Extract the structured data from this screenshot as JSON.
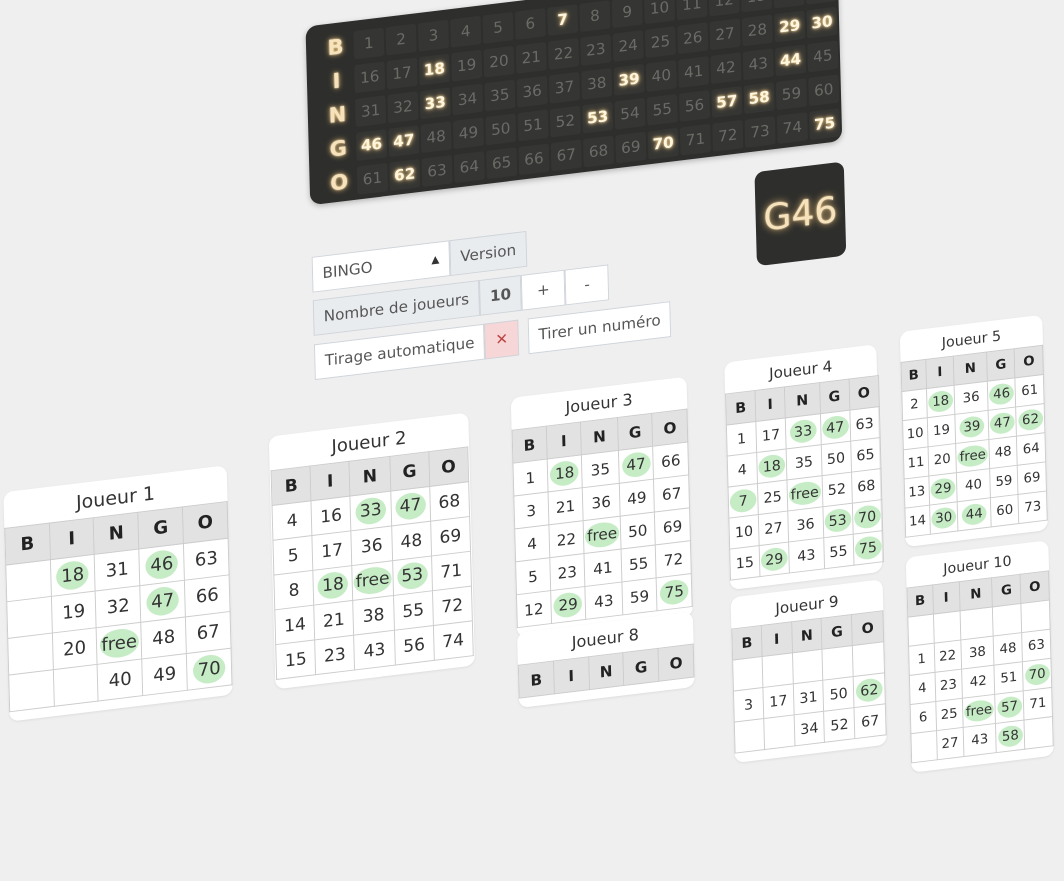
{
  "board": {
    "letters": [
      "B",
      "I",
      "N",
      "G",
      "O"
    ],
    "drawn": [
      7,
      18,
      29,
      30,
      33,
      39,
      44,
      46,
      47,
      53,
      57,
      58,
      62,
      70,
      75
    ]
  },
  "last_drawn": "G46",
  "controls": {
    "mode_value": "BINGO",
    "version_label": "Version",
    "players_label": "Nombre de joueurs",
    "players_count": "10",
    "plus_label": "+",
    "minus_label": "-",
    "auto_label": "Tirage automatique",
    "auto_toggle": "✕",
    "draw_button": "Tirer un numéro"
  },
  "cards": [
    {
      "title": "Joueur 1",
      "rows": [
        [
          "",
          "18",
          "31",
          "46",
          "63"
        ],
        [
          "",
          "19",
          "32",
          "47",
          "66"
        ],
        [
          "",
          "20",
          "free",
          "48",
          "67"
        ],
        [
          "",
          "",
          "40",
          "49",
          "70"
        ]
      ]
    },
    {
      "title": "Joueur 2",
      "rows": [
        [
          "4",
          "16",
          "33",
          "47",
          "68"
        ],
        [
          "5",
          "17",
          "36",
          "48",
          "69"
        ],
        [
          "8",
          "18",
          "free",
          "53",
          "71"
        ],
        [
          "14",
          "21",
          "38",
          "55",
          "72"
        ],
        [
          "15",
          "23",
          "43",
          "56",
          "74"
        ]
      ]
    },
    {
      "title": "Joueur 3",
      "rows": [
        [
          "1",
          "18",
          "35",
          "47",
          "66"
        ],
        [
          "3",
          "21",
          "36",
          "49",
          "67"
        ],
        [
          "4",
          "22",
          "free",
          "50",
          "69"
        ],
        [
          "5",
          "23",
          "41",
          "55",
          "72"
        ],
        [
          "12",
          "29",
          "43",
          "59",
          "75"
        ]
      ]
    },
    {
      "title": "Joueur 4",
      "rows": [
        [
          "1",
          "17",
          "33",
          "47",
          "63"
        ],
        [
          "4",
          "18",
          "35",
          "50",
          "65"
        ],
        [
          "7",
          "25",
          "free",
          "52",
          "68"
        ],
        [
          "10",
          "27",
          "36",
          "53",
          "70"
        ],
        [
          "15",
          "29",
          "43",
          "55",
          "75"
        ]
      ]
    },
    {
      "title": "Joueur 5",
      "rows": [
        [
          "2",
          "18",
          "36",
          "46",
          "61"
        ],
        [
          "10",
          "19",
          "39",
          "47",
          "62"
        ],
        [
          "11",
          "20",
          "free",
          "48",
          "64"
        ],
        [
          "13",
          "29",
          "40",
          "59",
          "69"
        ],
        [
          "14",
          "30",
          "44",
          "60",
          "73"
        ]
      ]
    },
    {
      "title": "Joueur 8",
      "rows": []
    },
    {
      "title": "Joueur 9",
      "rows": [
        [
          "",
          "",
          "",
          "",
          ""
        ],
        [
          "3",
          "17",
          "31",
          "50",
          "62"
        ],
        [
          "",
          "",
          "34",
          "52",
          "67"
        ]
      ]
    },
    {
      "title": "Joueur 10",
      "rows": [
        [
          "",
          "",
          "",
          "",
          ""
        ],
        [
          "1",
          "22",
          "38",
          "48",
          "63"
        ],
        [
          "4",
          "23",
          "42",
          "51",
          "70"
        ],
        [
          "6",
          "25",
          "free",
          "57",
          "71"
        ],
        [
          "",
          "27",
          "43",
          "58",
          ""
        ]
      ]
    }
  ],
  "headers": [
    "B",
    "I",
    "N",
    "G",
    "O"
  ]
}
